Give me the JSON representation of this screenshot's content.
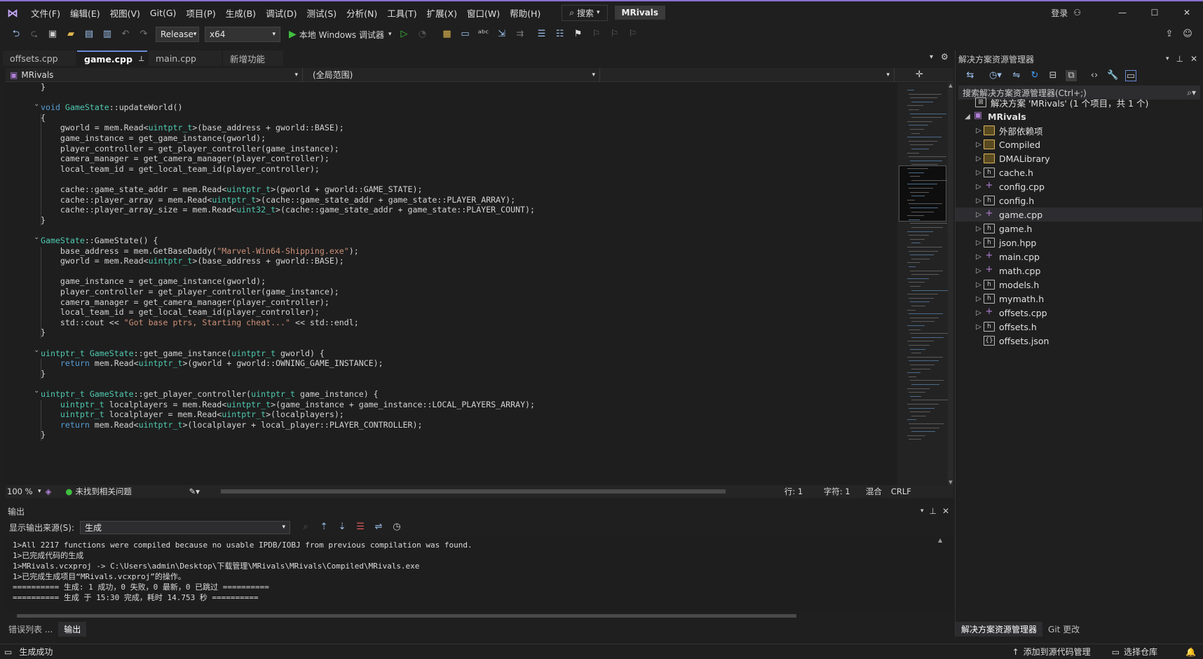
{
  "menu": {
    "items": [
      "文件(F)",
      "编辑(E)",
      "视图(V)",
      "Git(G)",
      "项目(P)",
      "生成(B)",
      "调试(D)",
      "测试(S)",
      "分析(N)",
      "工具(T)",
      "扩展(X)",
      "窗口(W)",
      "帮助(H)"
    ],
    "search_label": "搜索",
    "project_name": "MRivals",
    "login_label": "登录"
  },
  "toolbar": {
    "configuration": "Release",
    "platform": "x64",
    "run_label": "本地 Windows 调试器"
  },
  "doc_tabs": [
    {
      "label": "offsets.cpp",
      "active": false
    },
    {
      "label": "game.cpp",
      "active": true
    },
    {
      "label": "main.cpp",
      "active": false
    },
    {
      "label": "新增功能",
      "active": false
    }
  ],
  "navbar": {
    "project": "MRivals",
    "scope": "(全局范围)"
  },
  "editor": {
    "zoom": "100 %",
    "issues": "未找到相关问题",
    "line": "行: 1",
    "col": "字符: 1",
    "encoding": "混合",
    "eol": "CRLF"
  },
  "output": {
    "title": "输出",
    "source_label": "显示输出来源(S):",
    "source_value": "生成",
    "lines": [
      "1>All 2217 functions were compiled because no usable IPDB/IOBJ from previous compilation was found.",
      "1>已完成代码的生成",
      "1>MRivals.vcxproj -> C:\\Users\\admin\\Desktop\\下载管理\\MRivals\\MRivals\\Compiled\\MRivals.exe",
      "1>已完成生成项目“MRivals.vcxproj”的操作。",
      "========== 生成: 1 成功，0 失败，0 最新，0 已跳过 ==========",
      "========== 生成 于 15:30 完成，耗时 14.753 秒 =========="
    ]
  },
  "bottom_tabs": [
    "错误列表 ...",
    "输出"
  ],
  "solution": {
    "title": "解决方案资源管理器",
    "search_placeholder": "搜索解决方案资源管理器(Ctrl+;)",
    "solution_label": "解决方案 'MRivals' (1 个项目，共 1 个)",
    "project": "MRivals",
    "items": [
      {
        "label": "外部依赖项",
        "kind": "folder"
      },
      {
        "label": "Compiled",
        "kind": "folder"
      },
      {
        "label": "DMALibrary",
        "kind": "folder"
      },
      {
        "label": "cache.h",
        "kind": "h"
      },
      {
        "label": "config.cpp",
        "kind": "cpp"
      },
      {
        "label": "config.h",
        "kind": "h"
      },
      {
        "label": "game.cpp",
        "kind": "cpp"
      },
      {
        "label": "game.h",
        "kind": "h"
      },
      {
        "label": "json.hpp",
        "kind": "h"
      },
      {
        "label": "main.cpp",
        "kind": "cpp"
      },
      {
        "label": "math.cpp",
        "kind": "cpp"
      },
      {
        "label": "models.h",
        "kind": "h"
      },
      {
        "label": "mymath.h",
        "kind": "h"
      },
      {
        "label": "offsets.cpp",
        "kind": "cpp"
      },
      {
        "label": "offsets.h",
        "kind": "h"
      },
      {
        "label": "offsets.json",
        "kind": "json"
      }
    ],
    "tab_active": "解决方案资源管理器",
    "tab_other": "Git 更改"
  },
  "statusbar": {
    "left": "生成成功",
    "add_source": "添加到源代码管理",
    "select_repo": "选择仓库"
  },
  "code": [
    "}",
    "",
    "void GameState::updateWorld()",
    "{",
    "    gworld = mem.Read<uintptr_t>(base_address + gworld::BASE);",
    "    game_instance = get_game_instance(gworld);",
    "    player_controller = get_player_controller(game_instance);",
    "    camera_manager = get_camera_manager(player_controller);",
    "    local_team_id = get_local_team_id(player_controller);",
    "",
    "    cache::game_state_addr = mem.Read<uintptr_t>(gworld + gworld::GAME_STATE);",
    "    cache::player_array = mem.Read<uintptr_t>(cache::game_state_addr + game_state::PLAYER_ARRAY);",
    "    cache::player_array_size = mem.Read<uint32_t>(cache::game_state_addr + game_state::PLAYER_COUNT);",
    "}",
    "",
    "GameState::GameState() {",
    "    base_address = mem.GetBaseDaddy(\"Marvel-Win64-Shipping.exe\");",
    "    gworld = mem.Read<uintptr_t>(base_address + gworld::BASE);",
    "",
    "    game_instance = get_game_instance(gworld);",
    "    player_controller = get_player_controller(game_instance);",
    "    camera_manager = get_camera_manager(player_controller);",
    "    local_team_id = get_local_team_id(player_controller);",
    "    std::cout << \"Got base ptrs, Starting cheat...\" << std::endl;",
    "}",
    "",
    "uintptr_t GameState::get_game_instance(uintptr_t gworld) {",
    "    return mem.Read<uintptr_t>(gworld + gworld::OWNING_GAME_INSTANCE);",
    "}",
    "",
    "uintptr_t GameState::get_player_controller(uintptr_t game_instance) {",
    "    uintptr_t localplayers = mem.Read<uintptr_t>(game_instance + game_instance::LOCAL_PLAYERS_ARRAY);",
    "    uintptr_t localplayer = mem.Read<uintptr_t>(localplayers);",
    "    return mem.Read<uintptr_t>(localplayer + local_player::PLAYER_CONTROLLER);",
    "}"
  ],
  "colors": {
    "accent": "#8a6fd1",
    "keyword": "#569cd6",
    "type": "#4ec9b0",
    "function": "#dcdcaa",
    "string": "#ce9178"
  }
}
